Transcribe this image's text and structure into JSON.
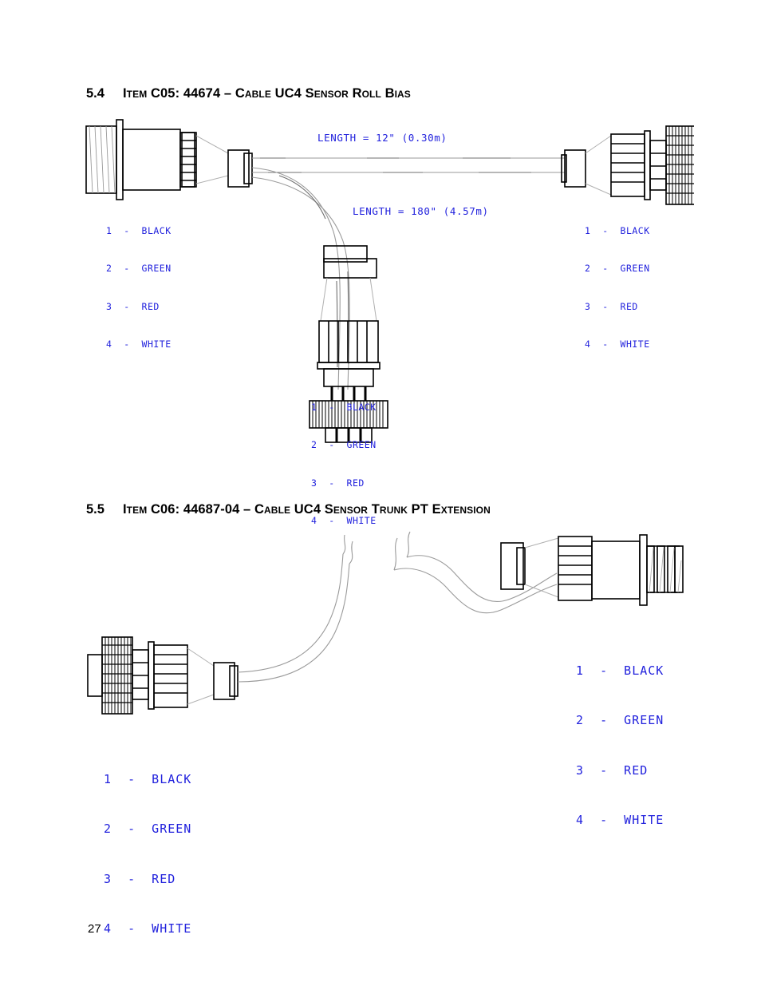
{
  "page": {
    "number": "27"
  },
  "sections": [
    {
      "id": "c05",
      "number": "5.4",
      "title": "Item C05:  44674 – Cable UC4 Sensor Roll Bias",
      "labels": {
        "length_trunk": "LENGTH = 12\" (0.30m)",
        "length_branch": "LENGTH = 180\" (4.57m)"
      },
      "pinouts": [
        {
          "id": "c05-left",
          "rows": [
            "1  -  BLACK",
            "2  -  GREEN",
            "3  -  RED",
            "4  -  WHITE"
          ]
        },
        {
          "id": "c05-right",
          "rows": [
            "1  -  BLACK",
            "2  -  GREEN",
            "3  -  RED",
            "4  -  WHITE"
          ]
        },
        {
          "id": "c05-branch",
          "rows": [
            "1  -  BLACK",
            "2  -  GREEN",
            "3  -  RED",
            "4  -  WHITE"
          ]
        }
      ]
    },
    {
      "id": "c06",
      "number": "5.5",
      "title": "Item C06:  44687-04 – Cable UC4 Sensor Trunk PT Extension",
      "labels": {},
      "pinouts": [
        {
          "id": "c06-left",
          "rows": [
            "1  -  BLACK",
            "2  -  GREEN",
            "3  -  RED",
            "4  -  WHITE"
          ]
        },
        {
          "id": "c06-right",
          "rows": [
            "1  -  BLACK",
            "2  -  GREEN",
            "3  -  RED",
            "4  -  WHITE"
          ]
        }
      ]
    }
  ],
  "colors": {
    "annotation_blue": "#2222dd",
    "line_black": "#000000",
    "cable_gray": "#8a8a8a"
  }
}
